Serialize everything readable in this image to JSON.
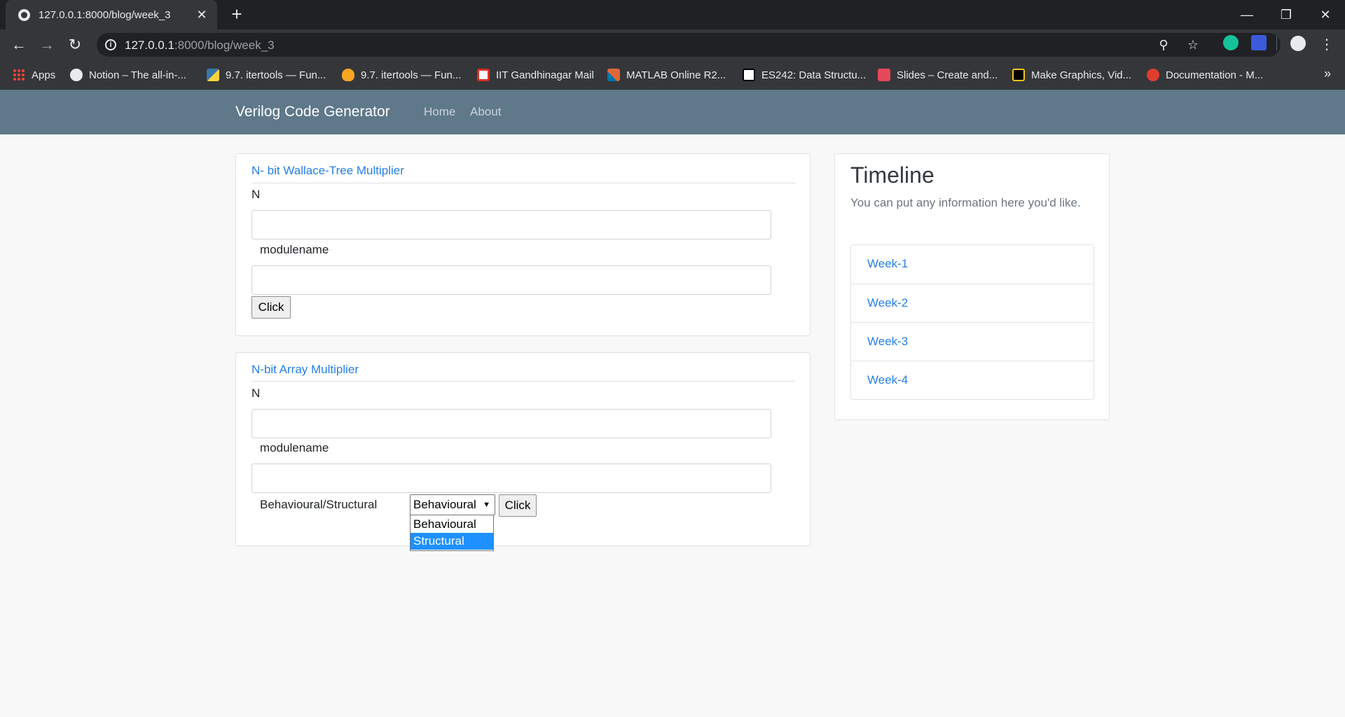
{
  "browser": {
    "tab_title": "127.0.0.1:8000/blog/week_3",
    "url_host": "127.0.0.1",
    "url_rest": ":8000/blog/week_3",
    "bookmarks": [
      "Apps",
      "Notion – The all-in-...",
      "9.7. itertools — Fun...",
      "9.7. itertools — Fun...",
      "IIT Gandhinagar Mail",
      "MATLAB Online R2...",
      "ES242: Data Structu...",
      "Slides – Create and...",
      "Make Graphics, Vid...",
      "Documentation - M..."
    ],
    "bookmarks_more": "»"
  },
  "site": {
    "brand": "Verilog Code Generator",
    "nav": [
      "Home",
      "About"
    ]
  },
  "wallace": {
    "title": "N- bit Wallace-Tree Multiplier",
    "n_label": "N",
    "module_label": "modulename",
    "button": "Click"
  },
  "array": {
    "title": "N-bit Array Multiplier",
    "n_label": "N",
    "module_label": "modulename",
    "type_label": "Behavioural/Structural",
    "selected": "Behavioural",
    "options": [
      "Behavioural",
      "Structural"
    ],
    "highlighted_option": "Structural",
    "button": "Click"
  },
  "timeline": {
    "title": "Timeline",
    "text": "You can put any information here you'd like.",
    "items": [
      "Week-1",
      "Week-2",
      "Week-3",
      "Week-4"
    ]
  },
  "colors": {
    "navbar": "#5f788a",
    "link": "#2780e3",
    "highlight": "#1e90ff"
  }
}
